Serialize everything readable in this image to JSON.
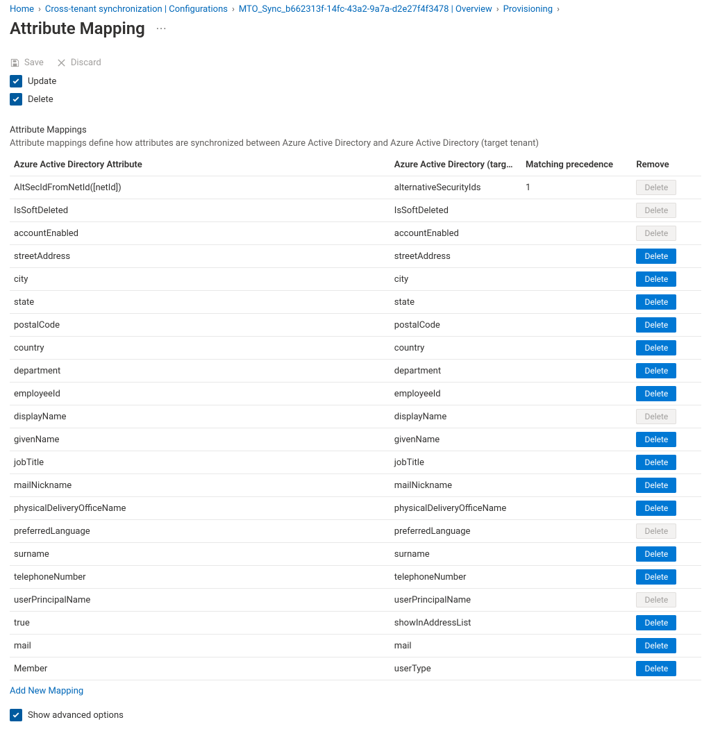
{
  "breadcrumb": [
    {
      "label": "Home"
    },
    {
      "label": "Cross-tenant synchronization | Configurations"
    },
    {
      "label": "MTO_Sync_b662313f-14fc-43a2-9a7a-d2e27f4f3478 | Overview"
    },
    {
      "label": "Provisioning"
    }
  ],
  "page": {
    "title": "Attribute Mapping",
    "more_actions": "···"
  },
  "toolbar": {
    "save": "Save",
    "discard": "Discard"
  },
  "options": {
    "update": "Update",
    "delete": "Delete",
    "show_advanced": "Show advanced options"
  },
  "section": {
    "title": "Attribute Mappings",
    "description": "Attribute mappings define how attributes are synchronized between Azure Active Directory and Azure Active Directory (target tenant)"
  },
  "table": {
    "headers": {
      "source": "Azure Active Directory Attribute",
      "target": "Azure Active Directory (target tenant) …",
      "precedence": "Matching precedence",
      "remove": "Remove"
    },
    "delete_label": "Delete",
    "rows": [
      {
        "source": "AltSecIdFromNetId([netId])",
        "target": "alternativeSecurityIds",
        "precedence": "1",
        "deletable": false
      },
      {
        "source": "IsSoftDeleted",
        "target": "IsSoftDeleted",
        "precedence": "",
        "deletable": false
      },
      {
        "source": "accountEnabled",
        "target": "accountEnabled",
        "precedence": "",
        "deletable": false
      },
      {
        "source": "streetAddress",
        "target": "streetAddress",
        "precedence": "",
        "deletable": true
      },
      {
        "source": "city",
        "target": "city",
        "precedence": "",
        "deletable": true
      },
      {
        "source": "state",
        "target": "state",
        "precedence": "",
        "deletable": true
      },
      {
        "source": "postalCode",
        "target": "postalCode",
        "precedence": "",
        "deletable": true
      },
      {
        "source": "country",
        "target": "country",
        "precedence": "",
        "deletable": true
      },
      {
        "source": "department",
        "target": "department",
        "precedence": "",
        "deletable": true
      },
      {
        "source": "employeeId",
        "target": "employeeId",
        "precedence": "",
        "deletable": true
      },
      {
        "source": "displayName",
        "target": "displayName",
        "precedence": "",
        "deletable": false
      },
      {
        "source": "givenName",
        "target": "givenName",
        "precedence": "",
        "deletable": true
      },
      {
        "source": "jobTitle",
        "target": "jobTitle",
        "precedence": "",
        "deletable": true
      },
      {
        "source": "mailNickname",
        "target": "mailNickname",
        "precedence": "",
        "deletable": true
      },
      {
        "source": "physicalDeliveryOfficeName",
        "target": "physicalDeliveryOfficeName",
        "precedence": "",
        "deletable": true
      },
      {
        "source": "preferredLanguage",
        "target": "preferredLanguage",
        "precedence": "",
        "deletable": false
      },
      {
        "source": "surname",
        "target": "surname",
        "precedence": "",
        "deletable": true
      },
      {
        "source": "telephoneNumber",
        "target": "telephoneNumber",
        "precedence": "",
        "deletable": true
      },
      {
        "source": "userPrincipalName",
        "target": "userPrincipalName",
        "precedence": "",
        "deletable": false
      },
      {
        "source": "true",
        "target": "showInAddressList",
        "precedence": "",
        "deletable": true
      },
      {
        "source": "mail",
        "target": "mail",
        "precedence": "",
        "deletable": true
      },
      {
        "source": "Member",
        "target": "userType",
        "precedence": "",
        "deletable": true
      }
    ]
  },
  "add_new": "Add New Mapping"
}
